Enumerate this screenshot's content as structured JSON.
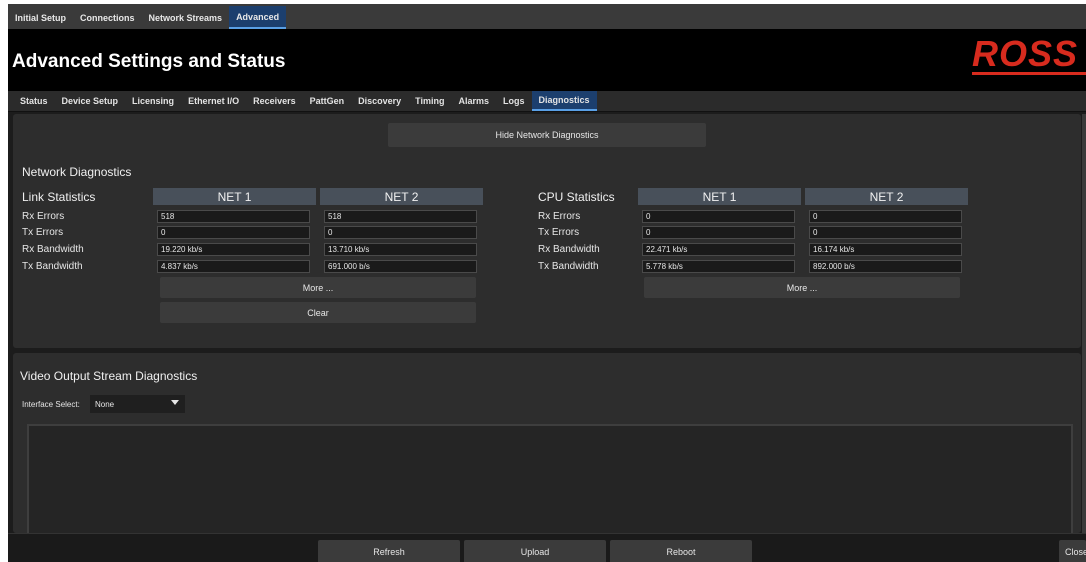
{
  "top_tabs": [
    "Initial Setup",
    "Connections",
    "Network Streams",
    "Advanced"
  ],
  "header": {
    "title": "Advanced Settings and Status",
    "logo": "ROSS"
  },
  "sub_tabs": [
    "Status",
    "Device Setup",
    "Licensing",
    "Ethernet I/O",
    "Receivers",
    "PattGen",
    "Discovery",
    "Timing",
    "Alarms",
    "Logs",
    "Diagnostics"
  ],
  "network": {
    "hide_button": "Hide Network Diagnostics",
    "section_title": "Network Diagnostics",
    "link": {
      "title": "Link Statistics",
      "col1": "NET 1",
      "col2": "NET 2",
      "rows": [
        {
          "label": "Rx Errors",
          "net1": "518",
          "net2": "518"
        },
        {
          "label": "Tx Errors",
          "net1": "0",
          "net2": "0"
        },
        {
          "label": "Rx Bandwidth",
          "net1": "19.220 kb/s",
          "net2": "13.710 kb/s"
        },
        {
          "label": "Tx Bandwidth",
          "net1": "4.837 kb/s",
          "net2": "691.000 b/s"
        }
      ],
      "more": "More ...",
      "clear": "Clear"
    },
    "cpu": {
      "title": "CPU Statistics",
      "col1": "NET 1",
      "col2": "NET 2",
      "rows": [
        {
          "label": "Rx Errors",
          "net1": "0",
          "net2": "0"
        },
        {
          "label": "Tx Errors",
          "net1": "0",
          "net2": "0"
        },
        {
          "label": "Rx Bandwidth",
          "net1": "22.471 kb/s",
          "net2": "16.174 kb/s"
        },
        {
          "label": "Tx Bandwidth",
          "net1": "5.778 kb/s",
          "net2": "892.000 b/s"
        }
      ],
      "more": "More ..."
    }
  },
  "video": {
    "section_title": "Video Output Stream Diagnostics",
    "interface_label": "Interface Select:",
    "interface_value": "None"
  },
  "bottom": {
    "refresh": "Refresh",
    "upload": "Upload",
    "reboot": "Reboot",
    "close": "Close"
  }
}
